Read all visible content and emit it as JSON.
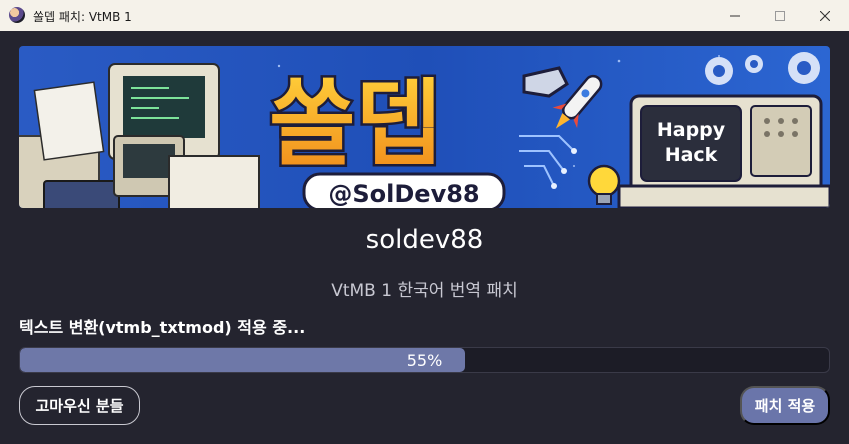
{
  "window": {
    "title": "쏠뎁 패치: VtMB 1",
    "icon": "app-icon"
  },
  "banner": {
    "logo_text": "쏠뎁",
    "handle_text": "@SolDev88",
    "monitor_text_line1": "Happy",
    "monitor_text_line2": "Hack"
  },
  "main": {
    "author": "soldev88",
    "subtitle": "VtMB 1 한국어 번역 패치",
    "status": "텍스트 변환(vtmb_txtmod) 적용 중..."
  },
  "progress": {
    "value": 0.55,
    "label": "55%"
  },
  "buttons": {
    "thanks_label": "고마우신 분들",
    "apply_label": "패치 적용"
  },
  "colors": {
    "background": "#24242f",
    "accent": "#6a75aa",
    "progress_fill": "#6e78a8",
    "titlebar": "#f5f2ea"
  }
}
